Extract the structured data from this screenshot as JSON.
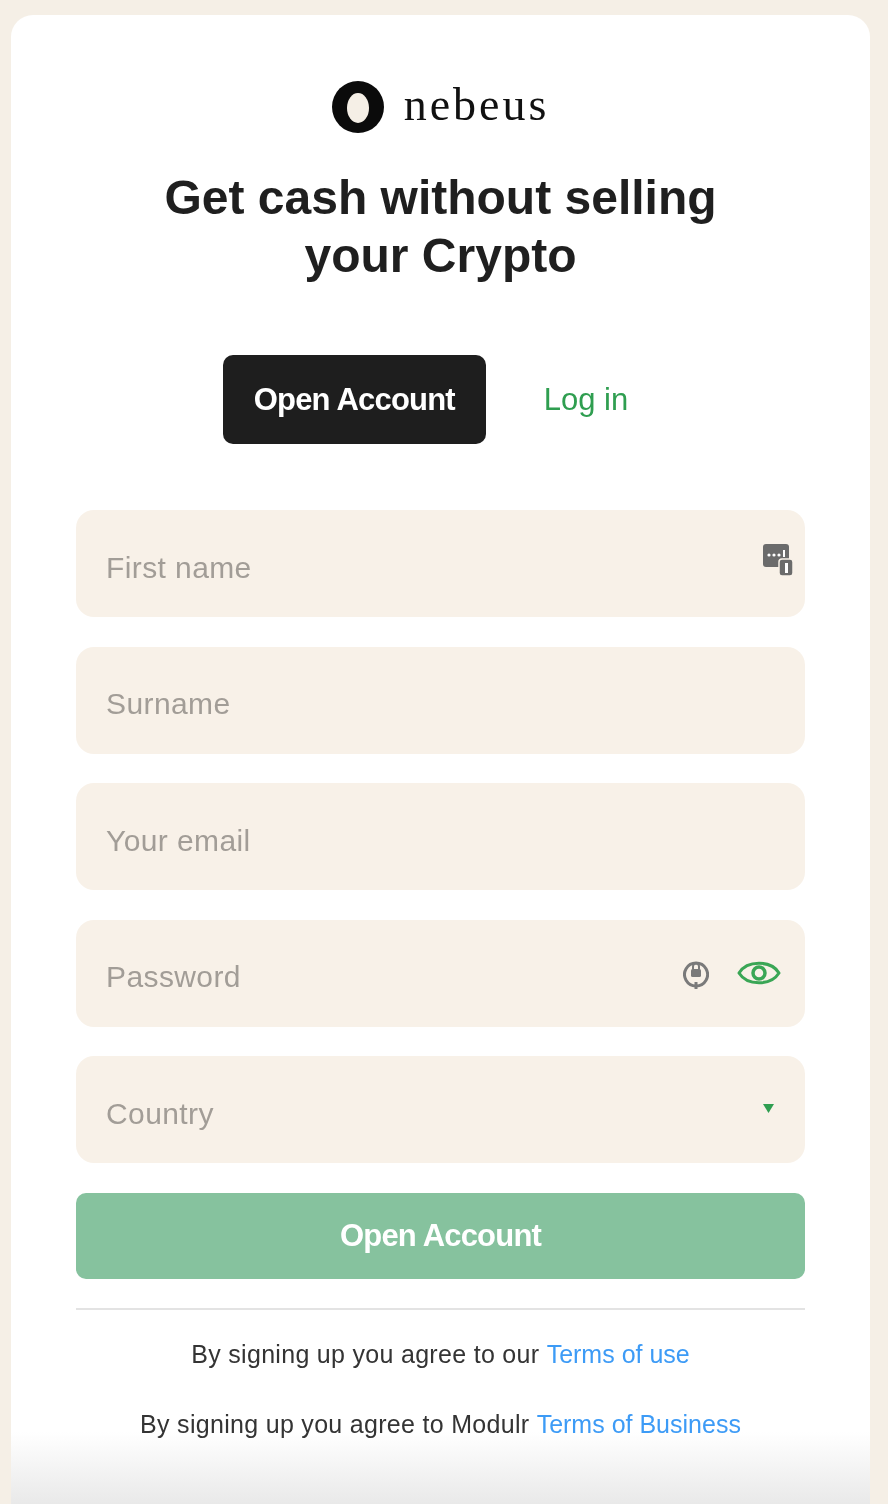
{
  "logo": {
    "brand": "nebeus"
  },
  "heading": "Get cash without selling your Crypto",
  "tabs": [
    {
      "label": "Open Account",
      "selected": true
    },
    {
      "label": "Log in",
      "selected": false
    }
  ],
  "fields": [
    {
      "kind": "autofill",
      "placeholder": "First name"
    },
    {
      "kind": "text",
      "placeholder": "Surname"
    },
    {
      "kind": "text",
      "placeholder": "Your email"
    },
    {
      "kind": "password",
      "placeholder": "Password"
    },
    {
      "kind": "select",
      "placeholder": "Country"
    }
  ],
  "submit": {
    "label": "Open Account",
    "disabled": true
  },
  "legal": [
    {
      "text": "By signing up you agree to our",
      "link": "Terms of use"
    },
    {
      "text": "By signing up you agree to Modulr",
      "link": "Terms of Business"
    }
  ]
}
